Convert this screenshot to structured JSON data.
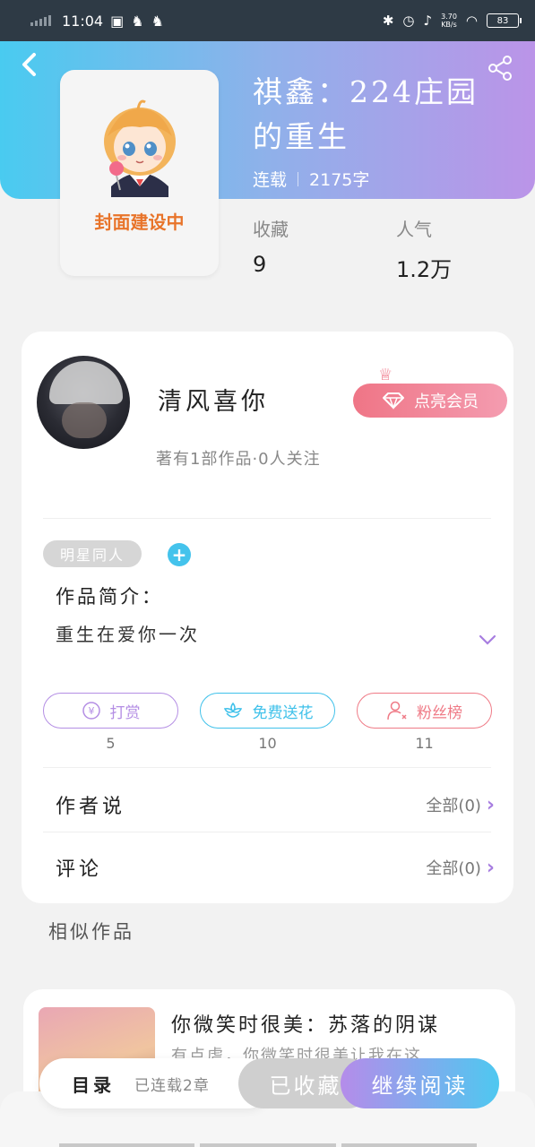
{
  "status_bar": {
    "time": "11:04",
    "net_speed_value": "3.70",
    "net_speed_unit": "KB/s",
    "battery": "83"
  },
  "header": {
    "back_icon": "back-icon",
    "share_icon": "share-icon"
  },
  "cover": {
    "placeholder_text": "封面建设中"
  },
  "book": {
    "title": "祺鑫：224庄园的重生",
    "status": "连载",
    "word_count": "2175字"
  },
  "stats": {
    "favorites_label": "收藏",
    "favorites_value": "9",
    "popularity_label": "人气",
    "popularity_value": "1.2万"
  },
  "author": {
    "name": "清风喜你",
    "works_info": "著有1部作品·0人关注",
    "vip_button": "点亮会员"
  },
  "intro": {
    "tag": "明星同人",
    "label": "作品简介：",
    "text": "重生在爱你一次"
  },
  "actions": [
    {
      "label": "打赏",
      "count": "5",
      "icon": "yen-icon",
      "color": "#b48ee4"
    },
    {
      "label": "免费送花",
      "count": "10",
      "icon": "flower-icon",
      "color": "#3fc1ea"
    },
    {
      "label": "粉丝榜",
      "count": "11",
      "icon": "fans-icon",
      "color": "#ef7a86"
    }
  ],
  "author_says": {
    "title": "作者说",
    "link": "全部(0)"
  },
  "comments": {
    "title": "评论",
    "link": "全部(0)"
  },
  "similar": {
    "title": "相似作品",
    "items": [
      {
        "title": "你微笑时很美：苏落的阴谋",
        "desc": "有点虐，你微笑时很美让我在这…"
      }
    ]
  },
  "bottom_bar": {
    "toc_label": "目录",
    "toc_status": "已连载2章",
    "favorited_label": "已收藏",
    "continue_label": "继续阅读"
  },
  "colors": {
    "header_start": "#49cbf0",
    "header_end": "#bb94e8",
    "accent_purple": "#b48ee4",
    "accent_cyan": "#3fc1ea",
    "accent_pink": "#ef7a86"
  }
}
